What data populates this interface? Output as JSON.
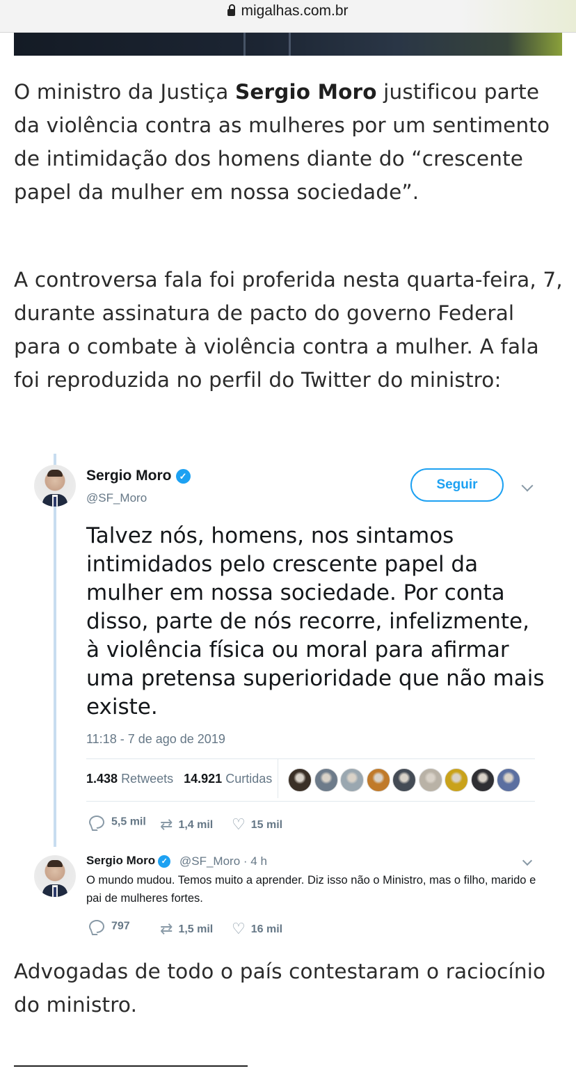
{
  "browser": {
    "url": "migalhas.com.br"
  },
  "article": {
    "p1_pre": "O ministro da Justiça ",
    "p1_bold": "Sergio Moro",
    "p1_post": " justificou parte da violência contra as mulheres por um sentimento de intimidação dos homens diante do “crescente papel da mulher em nossa sociedade”.",
    "p2": "A controversa fala foi proferida nesta quarta-feira, 7, durante assinatura de pacto do governo Federal para o combate à violência contra a mulher. A fala foi reproduzida no perfil do Twitter do ministro:",
    "p3": "Advogadas de todo o país contestaram o raciocínio do ministro."
  },
  "tweet": {
    "name": "Sergio Moro",
    "handle": "@SF_Moro",
    "follow_label": "Seguir",
    "text": "Talvez nós, homens, nos sintamos intimidados pelo crescente papel da mulher em nossa sociedade. Por conta disso, parte de nós recorre, infelizmente, à violência física ou moral para afirmar uma pretensa superioridade que não mais existe.",
    "timestamp": "11:18 - 7 de ago de 2019",
    "retweets_count": "1.438",
    "retweets_label": "Retweets",
    "likes_count": "14.921",
    "likes_label": "Curtidas",
    "likers": [
      "#3b3026",
      "#6d7b8a",
      "#9aa7b0",
      "#c07a2a",
      "#444b55",
      "#b9b2a6",
      "#c9a21b",
      "#2f2f33",
      "#5b6fa0"
    ],
    "replies": "5,5 mil",
    "retweets_short": "1,4 mil",
    "likes_short": "15 mil"
  },
  "reply_tweet": {
    "name": "Sergio Moro",
    "handle_time": "@SF_Moro · 4 h",
    "text": "O mundo mudou. Temos muito a aprender. Diz isso não o Ministro, mas o filho, marido e pai de mulheres fortes.",
    "replies": "797",
    "retweets": "1,5 mil",
    "likes": "16 mil"
  }
}
